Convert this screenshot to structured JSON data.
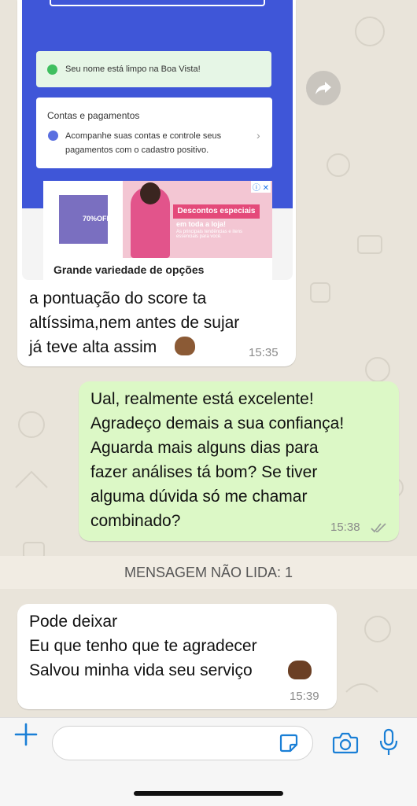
{
  "chat": {
    "messages": [
      {
        "direction": "incoming",
        "attachment": {
          "status_card": "Seu nome está limpo na Boa Vista!",
          "accounts_card": {
            "title": "Contas e pagamentos",
            "body": "Acompanhe suas contas e controle seus\npagamentos com o cadastro positivo."
          },
          "ad": {
            "thumb_text": "70%OFF",
            "banner": "Descontos especiais",
            "sub": "em toda a loja!",
            "small": "As principais tendências e itens essenciais para você.",
            "title": "Grande variedade de opções"
          }
        },
        "text": "a pontuação do score ta\naltíssima,nem antes de sujar\njá teve alta assim",
        "time": "15:35"
      },
      {
        "direction": "outgoing",
        "text": "Ual, realmente está excelente!\nAgradeço demais a sua confiança!\nAguarda mais alguns dias para\nfazer análises tá bom? Se tiver\nalguma dúvida só me chamar\ncombinado?",
        "time": "15:38",
        "status_icon": "double-check-icon"
      },
      {
        "direction": "incoming",
        "text": "Pode deixar\nEu que tenho que te agradecer\nSalvou minha vida seu serviço",
        "time": "15:39"
      }
    ],
    "unread_divider": "MENSAGEM NÃO LIDA: 1"
  },
  "composer": {
    "icons": [
      "plus-icon",
      "sticker-icon",
      "camera-icon",
      "microphone-icon"
    ],
    "accent_color": "#1a7fd6"
  }
}
